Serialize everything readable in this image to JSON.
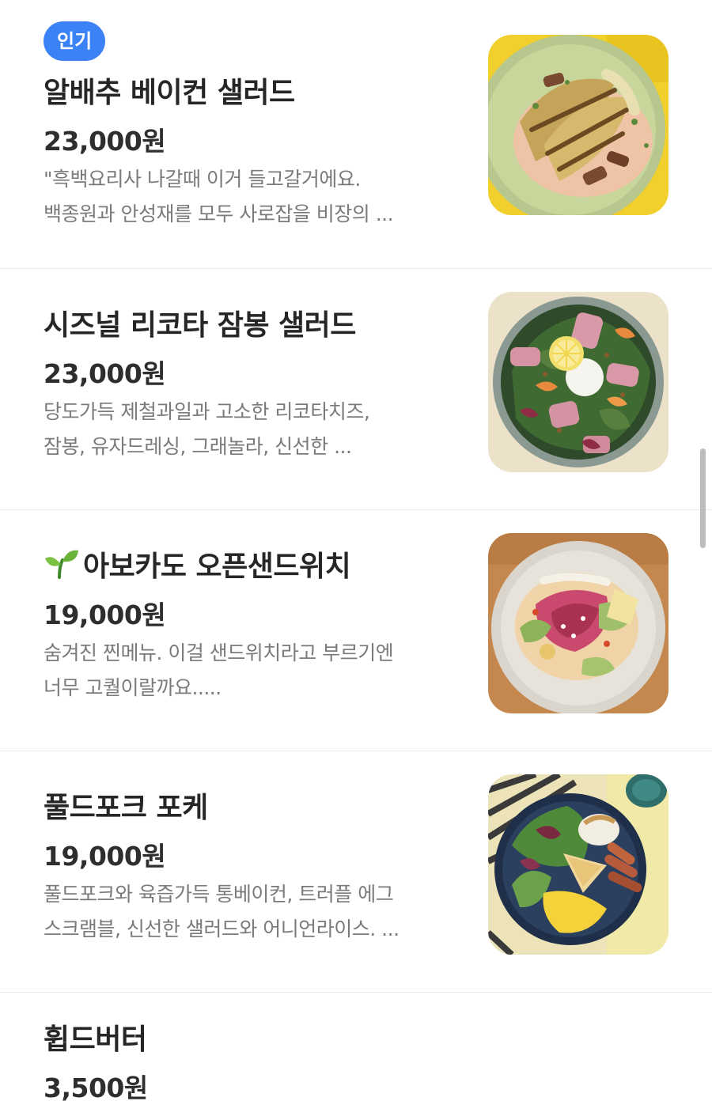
{
  "items": [
    {
      "badge": "인기",
      "name": "알배추 베이컨 샐러드",
      "price": "23,000원",
      "desc_line1": "\"흑백요리사 나갈때 이거 들고갈거에요.",
      "desc_line2": "백종원과 안성재를 모두 사로잡을 비장의 ...",
      "image_icon": "grilled-cabbage-bacon-salad-photo"
    },
    {
      "name": "시즈널 리코타 잠봉 샐러드",
      "price": "23,000원",
      "desc_line1": "당도가득 제철과일과  고소한 리코타치즈,",
      "desc_line2": "잠봉, 유자드레싱, 그래놀라, 신선한 ...",
      "image_icon": "ricotta-jambon-salad-photo"
    },
    {
      "name_prefix_icon": "sprout-icon",
      "name": "아보카도 오픈샌드위치",
      "price": "19,000원",
      "desc_line1": "숨겨진 찐메뉴. 이걸 샌드위치라고 부르기엔",
      "desc_line2": "너무 고퀄이랄까요.....",
      "image_icon": "avocado-open-sandwich-photo"
    },
    {
      "name": "풀드포크 포케",
      "price": "19,000원",
      "desc_line1": "풀드포크와 육즙가득 통베이컨, 트러플 에그",
      "desc_line2": "스크램블, 신선한 샐러드와 어니언라이스. ...",
      "image_icon": "pulled-pork-poke-bowl-photo"
    },
    {
      "name": "휩드버터",
      "price": "3,500원"
    }
  ],
  "colors": {
    "badge_bg": "#3a82f6",
    "text_primary": "#262626",
    "text_secondary": "#7a7a7a",
    "divider": "#ececec"
  }
}
